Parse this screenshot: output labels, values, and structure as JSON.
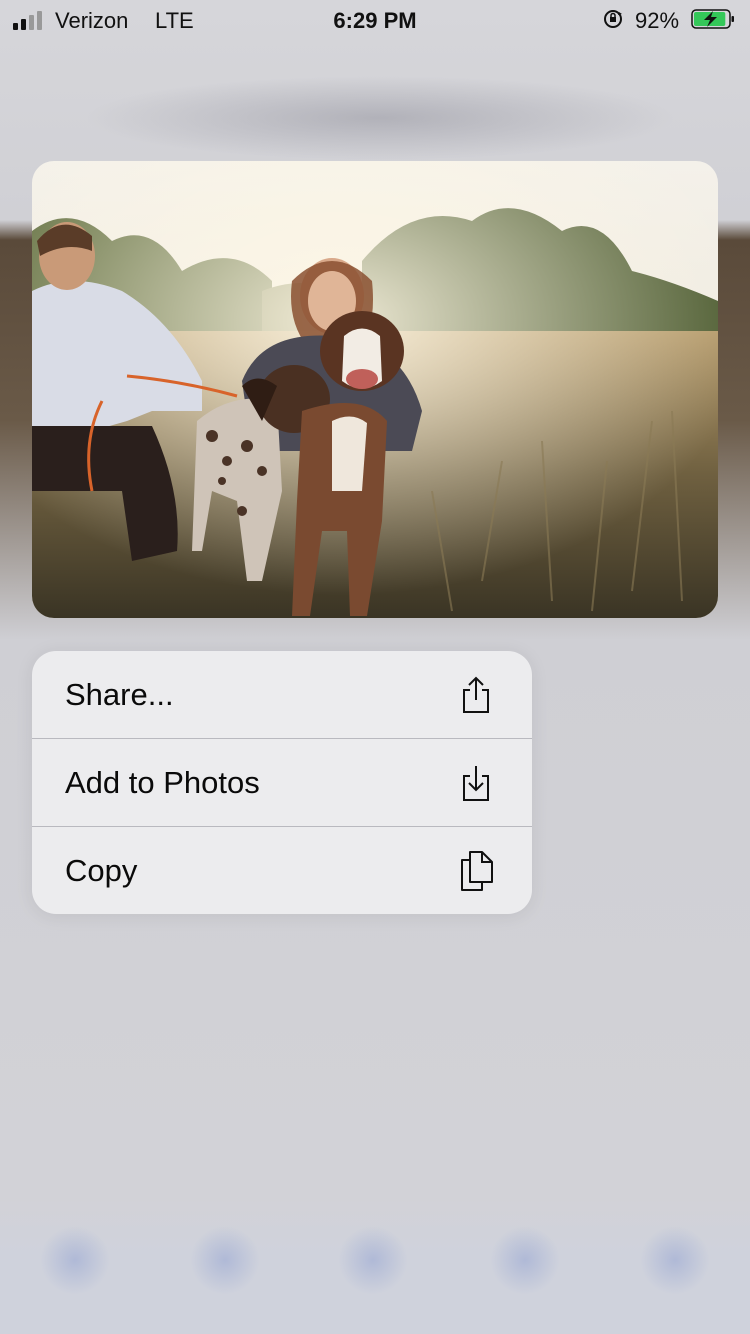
{
  "status_bar": {
    "carrier": "Verizon",
    "network": "LTE",
    "time": "6:29 PM",
    "battery_percent": "92%",
    "battery_level": 0.92,
    "signal_bars": 2,
    "icons": [
      "signal-icon",
      "orientation-lock-icon",
      "battery-charging-icon"
    ]
  },
  "preview": {
    "image": "photo-couple-with-two-dogs-in-field"
  },
  "context_menu": {
    "items": [
      {
        "label": "Share...",
        "icon": "share-icon"
      },
      {
        "label": "Add to Photos",
        "icon": "save-to-photos-icon"
      },
      {
        "label": "Copy",
        "icon": "copy-icon"
      }
    ]
  },
  "colors": {
    "menu_background": "#ececee",
    "divider": "#b9b9bf",
    "battery_fill": "#34c759"
  }
}
